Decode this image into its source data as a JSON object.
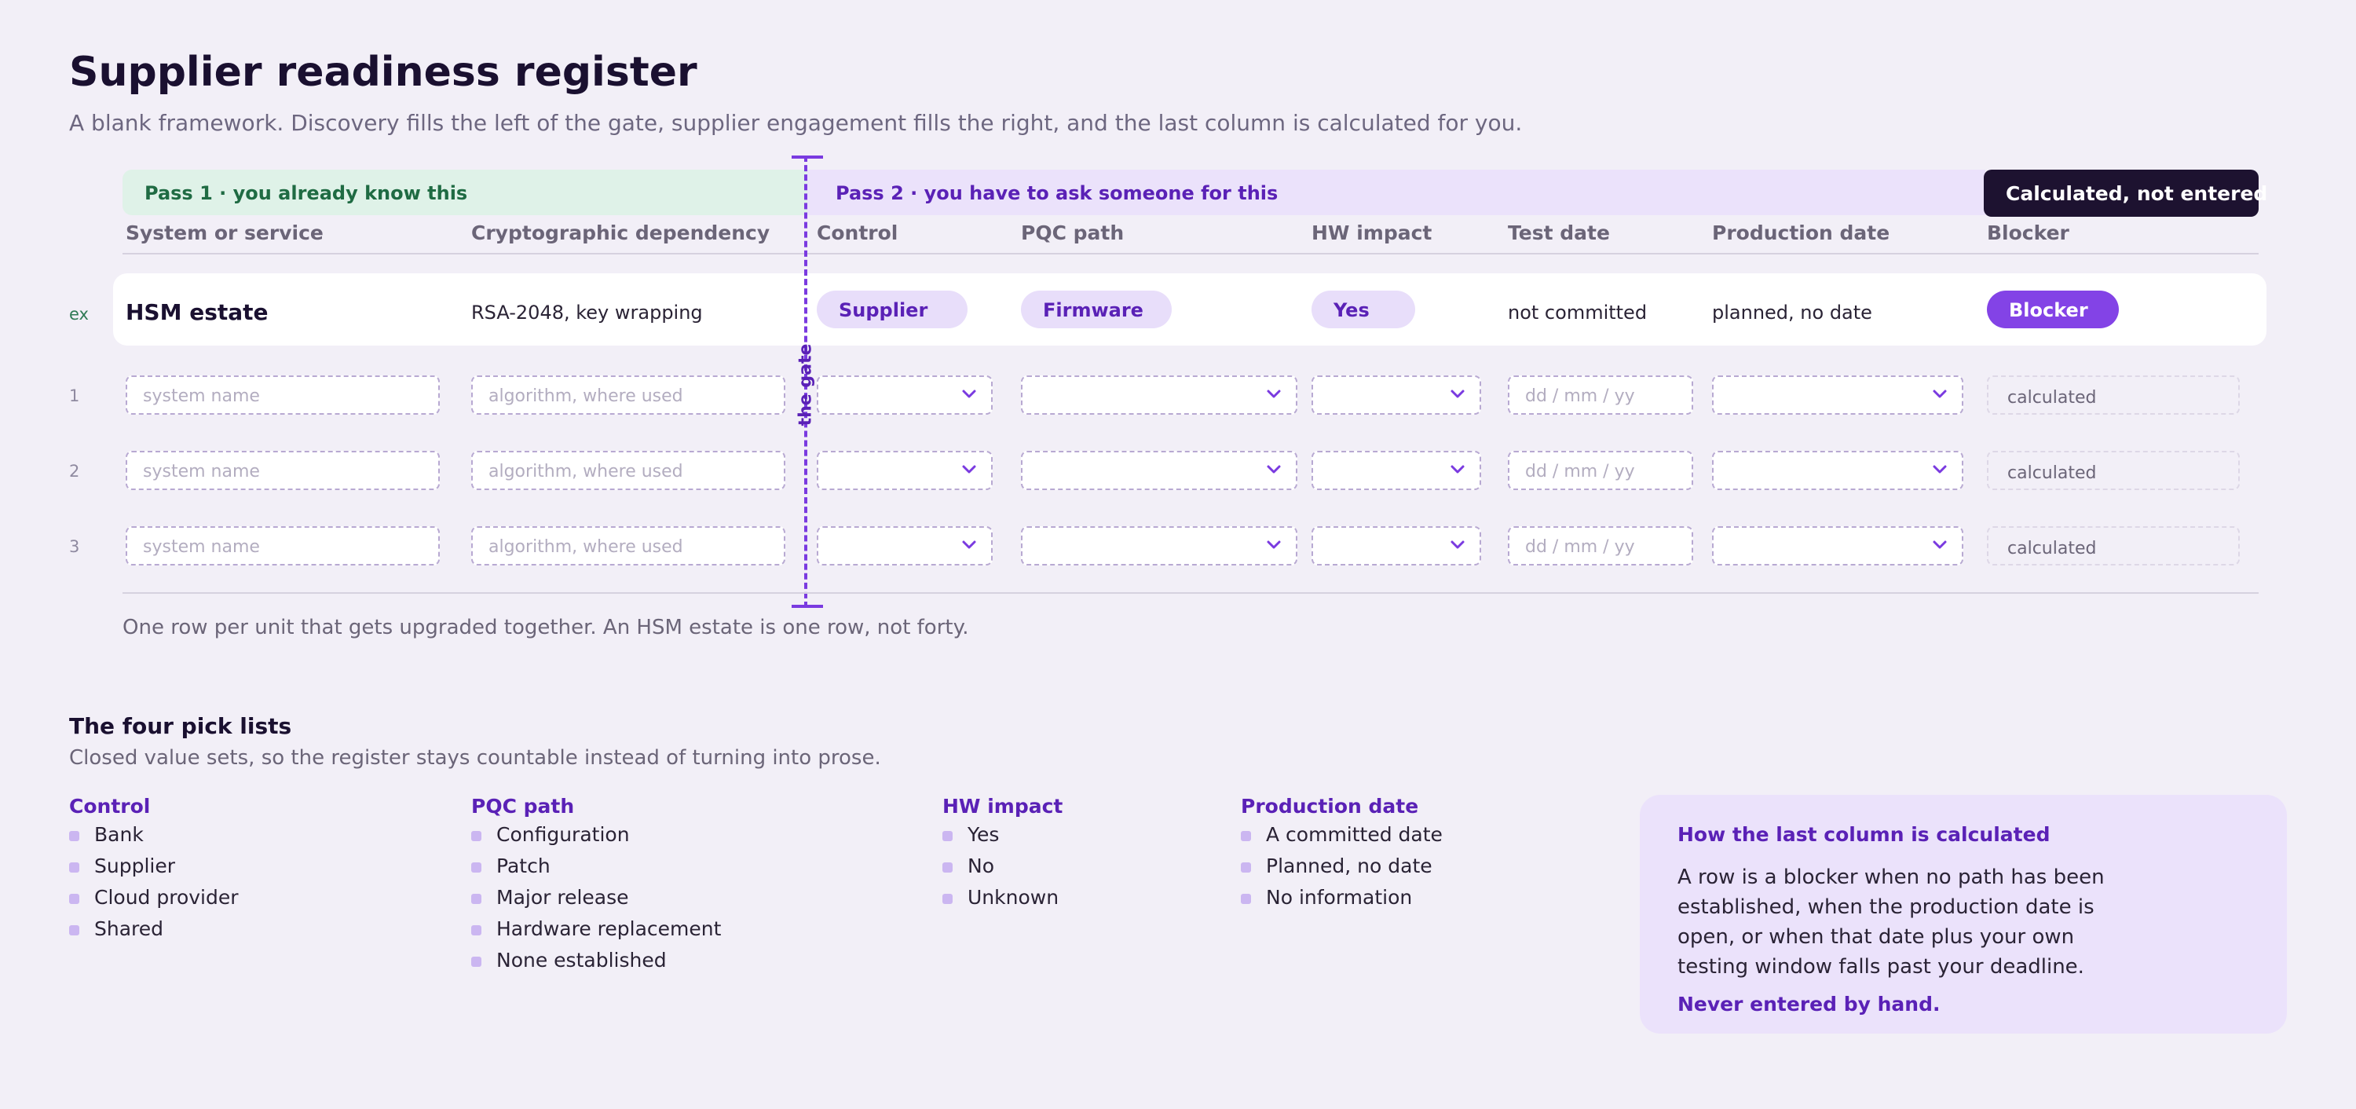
{
  "header": {
    "title": "Supplier readiness register",
    "subtitle": "A blank framework. Discovery fills the left of the gate, supplier engagement fills the right, and the last column is calculated for you."
  },
  "bands": {
    "pass1": "Pass 1 · you already know this",
    "pass2": "Pass 2 · you have to ask someone for this",
    "calculated": "Calculated, not entered"
  },
  "columns": [
    "System or service",
    "Cryptographic dependency",
    "Control",
    "PQC path",
    "HW impact",
    "Test date",
    "Production date",
    "Blocker"
  ],
  "gate_label": "the gate",
  "example_row": {
    "label": "ex",
    "system": "HSM estate",
    "dependency": "RSA-2048, key wrapping",
    "control": "Supplier",
    "pqc_path": "Firmware",
    "hw_impact": "Yes",
    "test_date": "not committed",
    "production_date": "planned, no date",
    "blocker": "Blocker"
  },
  "blank_rows": {
    "labels": [
      "1",
      "2",
      "3"
    ],
    "system_placeholder": "system name",
    "dependency_placeholder": "algorithm, where used",
    "date_placeholder": "dd / mm / yy",
    "calculated_text": "calculated"
  },
  "note": "One row per unit that gets upgraded together. An HSM estate is one row, not forty.",
  "picklists": {
    "title": "The four pick lists",
    "subtitle": "Closed value sets, so the register stays countable instead of turning into prose.",
    "lists": [
      {
        "title": "Control",
        "items": [
          "Bank",
          "Supplier",
          "Cloud provider",
          "Shared"
        ]
      },
      {
        "title": "PQC path",
        "items": [
          "Configuration",
          "Patch",
          "Major release",
          "Hardware replacement",
          "None established"
        ]
      },
      {
        "title": "HW impact",
        "items": [
          "Yes",
          "No",
          "Unknown"
        ]
      },
      {
        "title": "Production date",
        "items": [
          "A committed date",
          "Planned, no date",
          "No information"
        ]
      }
    ]
  },
  "info": {
    "title": "How the last column is calculated",
    "body": "A row is a blocker when no path has been established, when the production date is open, or when that date plus your own testing window falls past your deadline.",
    "footer": "Never entered by hand."
  },
  "colors": {
    "accent": "#5a21b6",
    "blocker": "#8343e6",
    "pass1_bg": "#dff2e8",
    "pass2_bg": "#ebe2fb",
    "dark": "#1d1230"
  }
}
